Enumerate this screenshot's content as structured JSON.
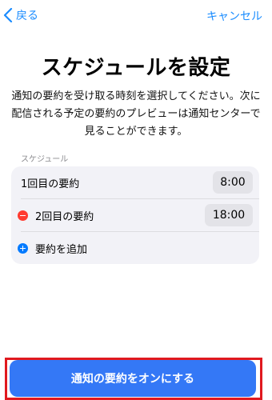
{
  "nav": {
    "back_label": "戻る",
    "cancel_label": "キャンセル",
    "accent_color": "#1a8cff"
  },
  "header": {
    "title": "スケジュールを設定",
    "description": "通知の要約を受け取る時刻を選択してください。次に配信される予定の要約のプレビューは通知センターで見ることができます。"
  },
  "schedule": {
    "section_label": "スケジュール",
    "items": [
      {
        "label": "1回目の要約",
        "time": "8:00",
        "removable": false
      },
      {
        "label": "2回目の要約",
        "time": "18:00",
        "removable": true
      }
    ],
    "add_label": "要約を追加"
  },
  "footer": {
    "primary_button_label": "通知の要約をオンにする",
    "button_color": "#3478f6",
    "highlight_color": "#e0191f"
  }
}
